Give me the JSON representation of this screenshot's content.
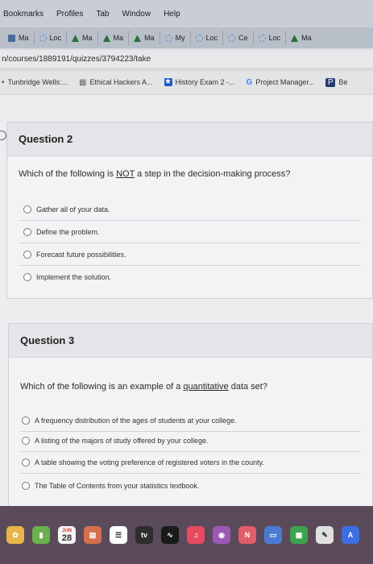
{
  "menubar": {
    "items": [
      "Bookmarks",
      "Profiles",
      "Tab",
      "Window",
      "Help"
    ]
  },
  "tabs": {
    "items": [
      "Ma",
      "Loc",
      "Ma",
      "Ma",
      "Ma",
      "My",
      "Loc",
      "Ce",
      "Loc",
      "Ma"
    ]
  },
  "address": {
    "url": "n/courses/1889191/quizzes/3794223/take"
  },
  "bookmarks": {
    "items": [
      "Tunbridge Wells:...",
      "Ethical Hackers A...",
      "History Exam 2 -...",
      "Project Manager...",
      "Be"
    ]
  },
  "question2": {
    "title": "Question 2",
    "text_before": "Which of the following is ",
    "text_underlined": "NOT",
    "text_after": " a step in the decision-making process?",
    "options": [
      "Gather all of your data.",
      "Define the problem.",
      "Forecast future possibilities.",
      "Implement the solution."
    ]
  },
  "question3": {
    "title": "Question 3",
    "text_before": "Which of the following is an example of a ",
    "text_underlined": "quantitative",
    "text_after": " data set?",
    "options": [
      "A frequency distribution of the ages of students at your college.",
      "A listing of the majors of study offered by your college.",
      "A table showing the voting preference of registered voters in the county.",
      "The Table of Contents from your statistics textbook."
    ]
  },
  "dock": {
    "calendar_month": "JUN",
    "calendar_day": "28",
    "tv_label": "tv"
  }
}
